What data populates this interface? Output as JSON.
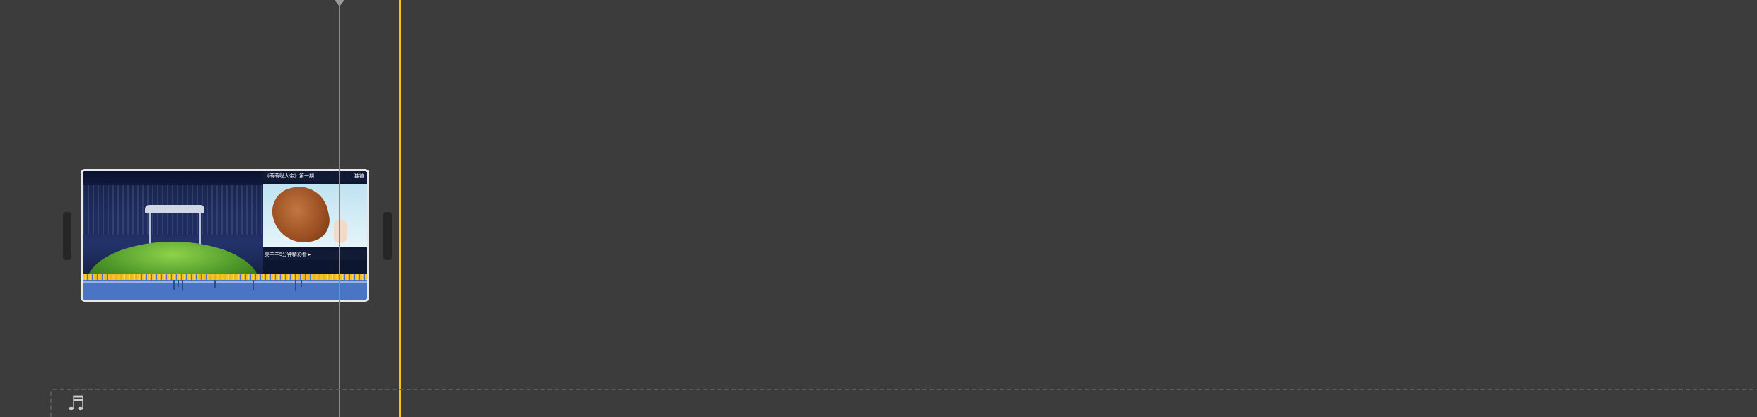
{
  "clip": {
    "title_text": "《萌萌哒大帝》第一期",
    "corner_text": "独链",
    "caption_text": "美羊羊5分钟精彩看 ▸"
  },
  "music_well": {
    "icon": "music-note-icon",
    "glyph": "♬"
  },
  "colors": {
    "background": "#3c3c3c",
    "playhead": "#f5c518",
    "skimmer": "#8a8a8a",
    "audio": "#4a74c4",
    "audio_peaks": "#f3c22a",
    "clip_border": "#e8e8e8"
  }
}
